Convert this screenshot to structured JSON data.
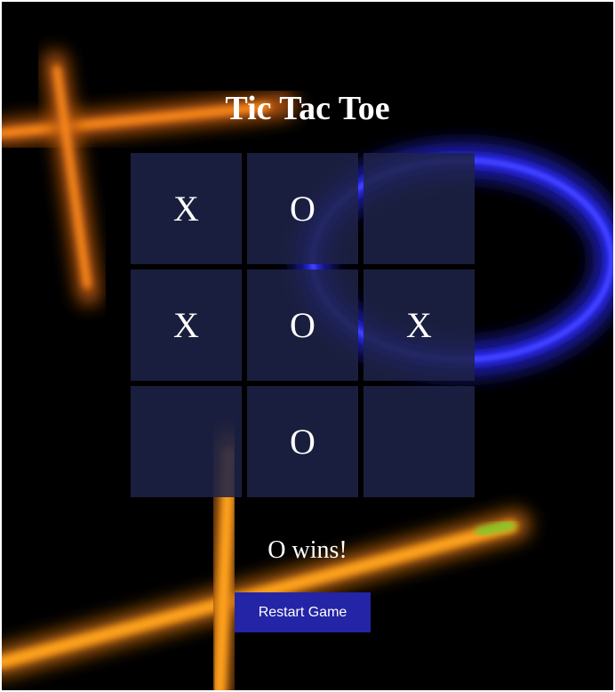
{
  "game": {
    "title": "Tic Tac Toe",
    "board": [
      "X",
      "O",
      "",
      "X",
      "O",
      "X",
      "",
      "O",
      ""
    ],
    "status": "O wins!",
    "restart_label": "Restart Game"
  },
  "colors": {
    "cell_bg": "#1e2348",
    "button_bg": "#2424a6",
    "text": "#ffffff",
    "background": "#000000"
  }
}
